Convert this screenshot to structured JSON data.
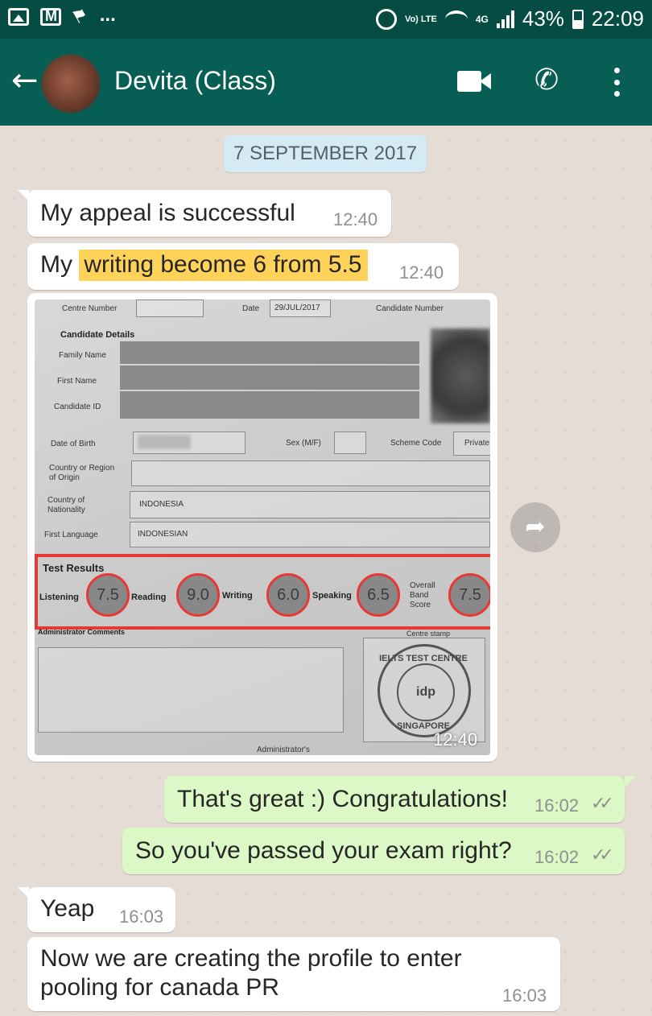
{
  "status_bar": {
    "network": "4G",
    "volte": "Vo) LTE",
    "battery": "43%",
    "time": "22:09",
    "dots": "...",
    "icons": [
      "gallery-icon",
      "gmail-icon",
      "flag-icon",
      "alarm-icon",
      "wifi-icon",
      "signal-icon",
      "battery-icon"
    ]
  },
  "header": {
    "contact_name": "Devita (Class)",
    "back_icon": "arrow-left",
    "back_glyph": "←",
    "call_glyph": "✆",
    "actions": [
      "video-call-icon",
      "voice-call-icon",
      "more-menu-icon"
    ]
  },
  "chat": {
    "date_chip": "7 SEPTEMBER 2017",
    "messages": [
      {
        "direction": "in",
        "text": "My appeal is successful",
        "time": "12:40"
      },
      {
        "direction": "in",
        "text_before": "My ",
        "text_highlight": "writing become 6 from 5.5",
        "time": "12:40"
      },
      {
        "direction": "in",
        "type": "image",
        "time": "12:40"
      },
      {
        "direction": "out",
        "text": "That's great :) Congratulations!",
        "time": "16:02",
        "ticks": "✓✓"
      },
      {
        "direction": "out",
        "text": "So you've passed your exam right?",
        "time": "16:02",
        "ticks": "✓✓"
      },
      {
        "direction": "in",
        "text": "Yeap",
        "time": "16:03"
      },
      {
        "direction": "in",
        "text_line1": "Now we are creating the profile to enter",
        "text_line2": "pooling for canada PR",
        "time": "16:03"
      }
    ],
    "share_glyph": "➦"
  },
  "photo": {
    "centre_number": "Centre Number",
    "date_label": "Date",
    "date_value": "29/JUL/2017",
    "candidate_number": "Candidate Number",
    "candidate_details": "Candidate Details",
    "family_name": "Family Name",
    "first_name": "First Name",
    "candidate_id": "Candidate ID",
    "dob": "Date of Birth",
    "sex": "Sex (M/F)",
    "scheme_code": "Scheme Code",
    "scheme_value": "Private",
    "country_region": "Country or Region",
    "of_origin": "of Origin",
    "country_of": "Country of",
    "nationality": "Nationality",
    "nationality_value": "INDONESIA",
    "first_language": "First Language",
    "language_value": "INDONESIAN",
    "test_results": "Test Results",
    "listening": "Listening",
    "reading": "Reading",
    "writing": "Writing",
    "speaking": "Speaking",
    "overall_1": "Overall",
    "overall_2": "Band",
    "overall_3": "Score",
    "scores": {
      "listening": "7.5",
      "reading": "9.0",
      "writing": "6.0",
      "speaking": "6.5",
      "overall": "7.5"
    },
    "admin_comments": "Administrator Comments",
    "centre_stamp": "Centre stamp",
    "stamp_top": "IELTS TEST CENTRE",
    "stamp_logo": "idp",
    "stamp_bottom": "SINGAPORE",
    "administrators": "Administrator's"
  },
  "colors": {
    "toolbar": "#075e54",
    "statusbar": "#054d44",
    "outgoing_bubble": "#dcf8c6",
    "incoming_bubble": "#ffffff",
    "highlight": "#ffd25a",
    "annotation_red": "#e53935",
    "date_chip": "#d4eaf4"
  }
}
